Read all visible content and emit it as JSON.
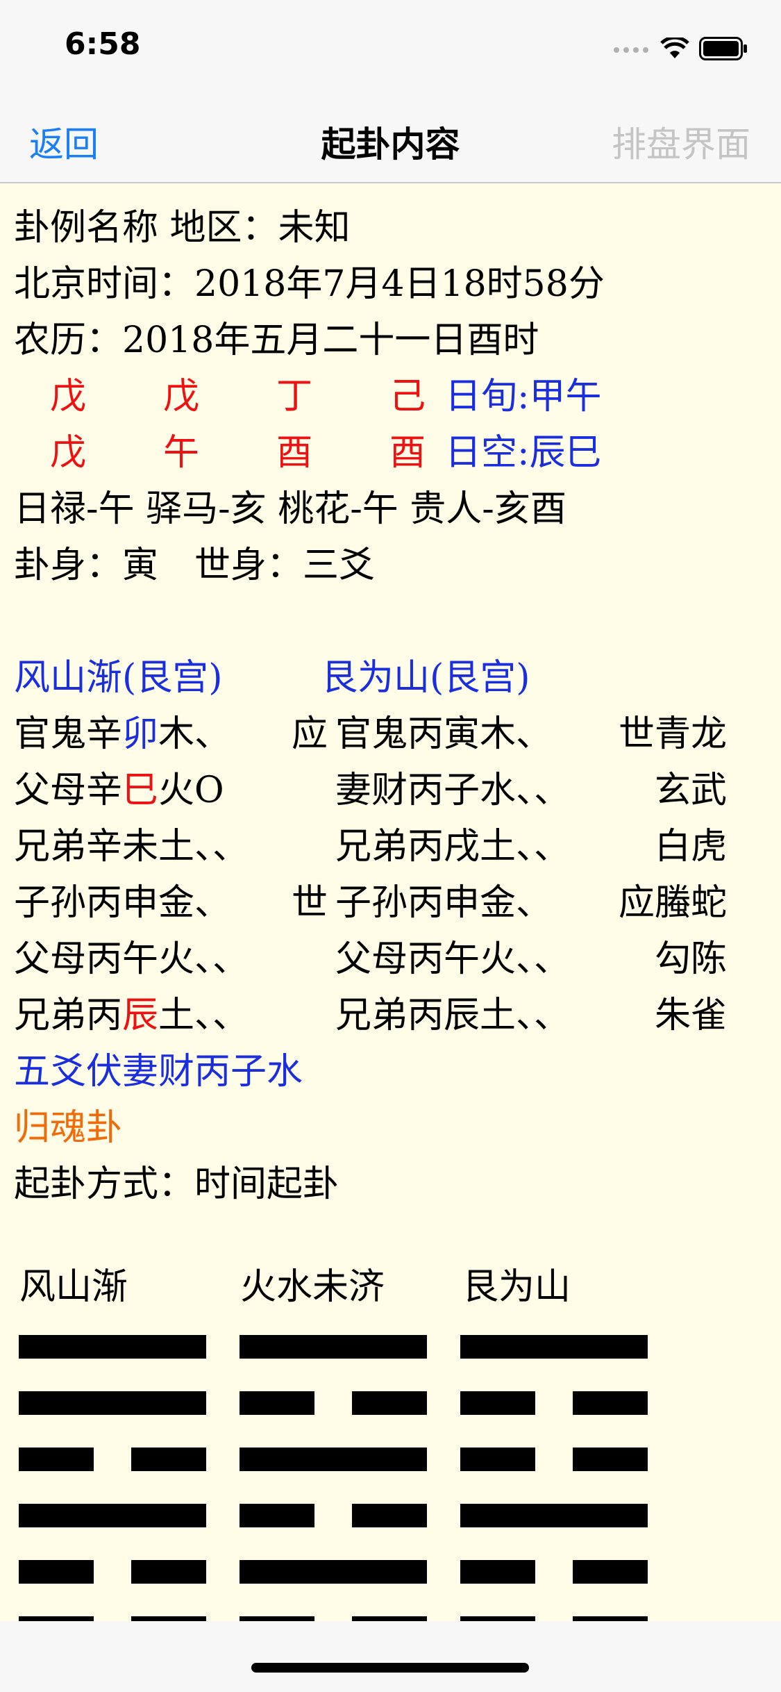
{
  "status": {
    "time": "6:58"
  },
  "nav": {
    "back": "返回",
    "title": "起卦内容",
    "right": "排盘界面"
  },
  "info": {
    "name_line": "卦例名称 地区：未知",
    "beijing_time": "北京时间：2018年7月4日18时58分",
    "lunar": "农历：2018年五月二十一日酉时"
  },
  "ganzhi": {
    "stems": [
      "戊",
      "戊",
      "丁",
      "己"
    ],
    "branches": [
      "戊",
      "午",
      "酉",
      "酉"
    ],
    "xun": "日旬:甲午",
    "kong": "日空:辰巳"
  },
  "shensha": "日禄-午 驿马-亥 桃花-午 贵人-亥酉",
  "guashen": "卦身：寅　世身：三爻",
  "main_gua": "风山渐(艮宫)",
  "changed_gua": "艮为山(艮宫)",
  "rows": [
    {
      "left_pre": "官鬼辛",
      "left_hi": "卯",
      "left_hi_color": "blue",
      "left_post": "木、",
      "mark": "应",
      "right": "官鬼丙寅木、",
      "god": "世青龙"
    },
    {
      "left_pre": "父母辛",
      "left_hi": "巳",
      "left_hi_color": "red",
      "left_post": "火O",
      "mark": "",
      "right": "妻财丙子水、、",
      "god": "玄武"
    },
    {
      "left_pre": "兄弟辛未土、、",
      "left_hi": "",
      "left_hi_color": "",
      "left_post": "",
      "mark": "",
      "right": "兄弟丙戌土、、",
      "god": "白虎"
    },
    {
      "left_pre": "子孙丙申金、",
      "left_hi": "",
      "left_hi_color": "",
      "left_post": "",
      "mark": "世",
      "right": "子孙丙申金、",
      "god": "应螣蛇"
    },
    {
      "left_pre": "父母丙午火、、",
      "left_hi": "",
      "left_hi_color": "",
      "left_post": "",
      "mark": "",
      "right": "父母丙午火、、",
      "god": "勾陈"
    },
    {
      "left_pre": "兄弟丙",
      "left_hi": "辰",
      "left_hi_color": "red",
      "left_post": "土、、",
      "mark": "",
      "right": "兄弟丙辰土、、",
      "god": "朱雀"
    }
  ],
  "fushen": "五爻伏妻财丙子水",
  "guihun": "归魂卦",
  "method": "起卦方式：时间起卦",
  "hexagrams": [
    {
      "name": "风山渐",
      "lines": [
        "yang",
        "yang",
        "yin",
        "yang",
        "yin",
        "yin"
      ]
    },
    {
      "name": "火水未济",
      "lines": [
        "yang",
        "yin",
        "yang",
        "yin",
        "yang",
        "yin"
      ]
    },
    {
      "name": "艮为山",
      "lines": [
        "yang",
        "yin",
        "yin",
        "yang",
        "yin",
        "yin"
      ]
    }
  ]
}
